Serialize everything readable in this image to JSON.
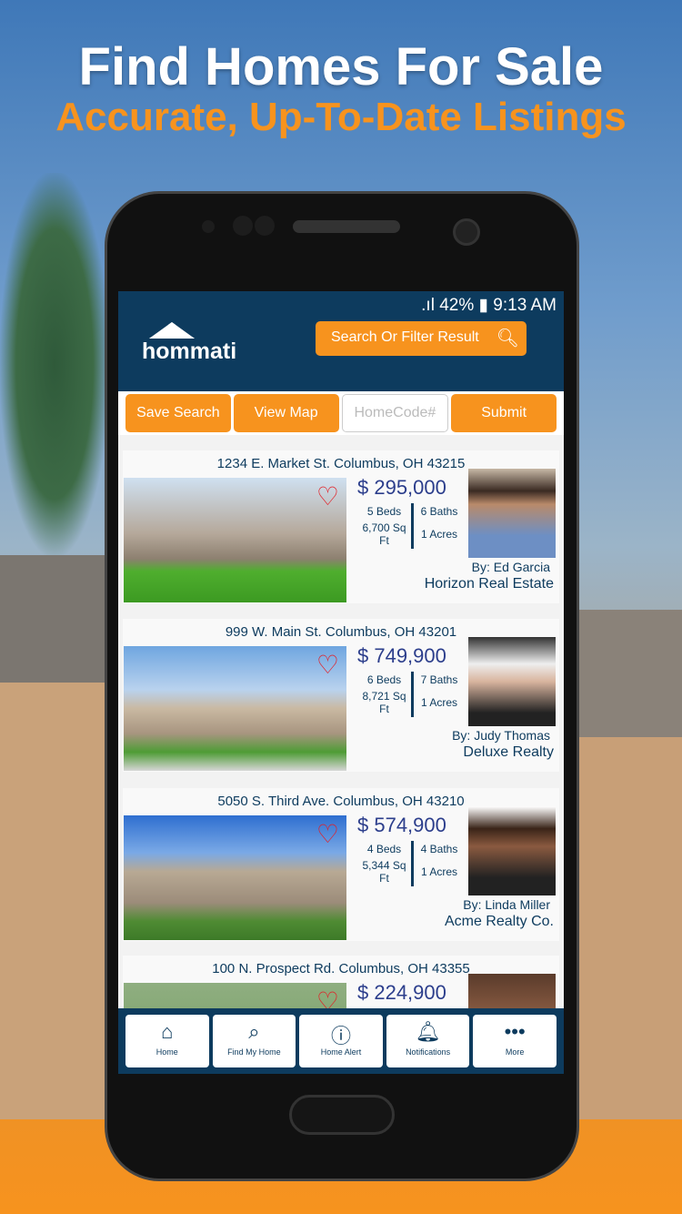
{
  "promo": {
    "title": "Find Homes For Sale",
    "subtitle": "Accurate, Up-To-Date Listings"
  },
  "status": {
    "battery": "42%",
    "time": "9:13 AM"
  },
  "header": {
    "logo": "hommati",
    "search_label": "Search Or Filter Result"
  },
  "actions": {
    "save": "Save Search",
    "map": "View Map",
    "homecode_placeholder": "HomeCode#",
    "submit": "Submit"
  },
  "listings": [
    {
      "address": "1234 E. Market St. Columbus, OH 43215",
      "price": "$ 295,000",
      "beds": "5 Beds",
      "baths": "6 Baths",
      "sqft": "6,700 Sq Ft",
      "acres": "1 Acres",
      "agent": "By:  Ed Garcia",
      "company": "Horizon Real Estate"
    },
    {
      "address": "999 W. Main St. Columbus, OH 43201",
      "price": "$ 749,900",
      "beds": "6 Beds",
      "baths": "7 Baths",
      "sqft": "8,721 Sq Ft",
      "acres": "1 Acres",
      "agent": "By:  Judy Thomas",
      "company": "Deluxe Realty"
    },
    {
      "address": "5050 S. Third Ave. Columbus, OH 43210",
      "price": "$ 574,900",
      "beds": "4 Beds",
      "baths": "4 Baths",
      "sqft": "5,344 Sq Ft",
      "acres": "1 Acres",
      "agent": "By:  Linda Miller",
      "company": "Acme Realty Co."
    },
    {
      "address": "100 N. Prospect Rd. Columbus, OH 43355",
      "price": "$  224,900"
    }
  ],
  "nav": [
    {
      "label": "Home",
      "icon": "home-icon"
    },
    {
      "label": "Find My Home",
      "icon": "find-home-icon"
    },
    {
      "label": "Home Alert",
      "icon": "alert-icon"
    },
    {
      "label": "Notifications",
      "icon": "bell-icon"
    },
    {
      "label": "More",
      "icon": "more-icon"
    }
  ],
  "colors": {
    "navy": "#0d3b5e",
    "orange": "#f7931e",
    "heart": "#e21f26"
  }
}
